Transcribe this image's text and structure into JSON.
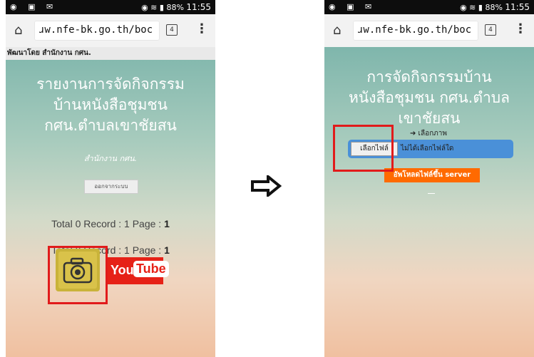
{
  "left_screen": {
    "status": {
      "time": "11:55",
      "battery": "88%"
    },
    "url": "ɹw.nfe-bk.go.th/boc",
    "tab_count": "4",
    "dev_banner": "พัฒนาโดย สำนักงาน กศน.",
    "title_lines": [
      "รายงานการจัดกิจกรรม",
      "บ้านหนังสือชุมชน",
      "กศน.ตำบลเขาชัยสน"
    ],
    "agency": "สำนักงาน กศน.",
    "logout_label": "ออกจากระบบ",
    "total1": {
      "prefix": "Total 0 Record : 1 Page : ",
      "page": "1"
    },
    "total2": {
      "prefix": "Total 0 Record : 1 Page : ",
      "page": "1"
    },
    "youtube": {
      "you": "You",
      "tube": "Tube"
    }
  },
  "right_screen": {
    "status": {
      "time": "11:55",
      "battery": "88%"
    },
    "url": "ɹw.nfe-bk.go.th/boc",
    "tab_count": "4",
    "title_lines": [
      "การจัดกิจกรรมบ้าน",
      "หนังสือชุมชน กศน.ตำบล",
      "เขาชัยสน"
    ],
    "choose_label": "➔ เลือกภาพ",
    "choose_file_button": "เลือกไฟล์",
    "no_file_text": "ไม่ได้เลือกไฟล์ใด",
    "upload_button": "อัพโหลดไฟล์ขึ้น server"
  },
  "colors": {
    "highlight": "#e11b1b",
    "upload": "#ff6a00",
    "file_bar": "#4a90d8"
  }
}
